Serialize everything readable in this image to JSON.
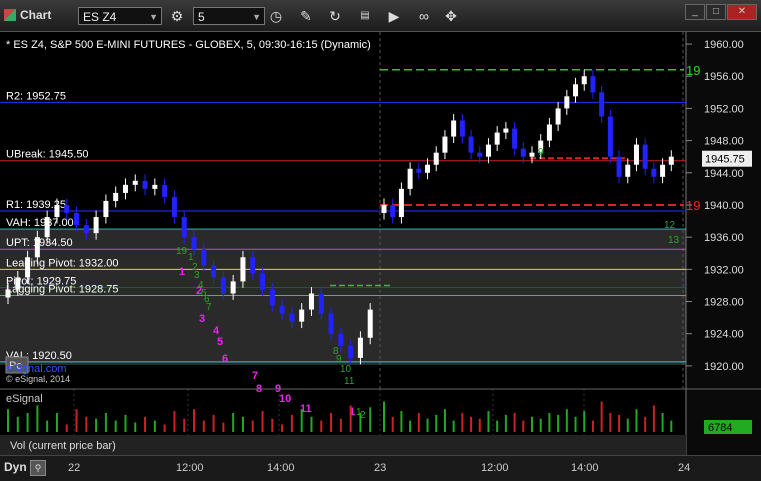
{
  "toolbar": {
    "title": "Chart",
    "symbol": "ES Z4",
    "interval": "5"
  },
  "chart": {
    "header": "* ES Z4, S&P 500 E-MINI FUTURES - GLOBEX, 5, 09:30-16:15 (Dynamic)",
    "copyright": "© eSignal, 2014",
    "watermark": "eSignal.com",
    "pc_label": "Pc",
    "volume_legend": "Vol (current price bar)",
    "volume_value": "6784",
    "last_price": "1945.75",
    "dyn_label": "Dyn"
  },
  "levels": [
    {
      "label": "R2: 1952.75",
      "price": 1952.75,
      "color": "#2233ff"
    },
    {
      "label": "UBreak: 1945.50",
      "price": 1945.5,
      "color": "#cc2020"
    },
    {
      "label": "R1: 1939.25",
      "price": 1939.25,
      "color": "#2233ff"
    },
    {
      "label": "VAH: 1937.00",
      "price": 1937.0,
      "color": "#33cccc"
    },
    {
      "label": "UPT: 1934.50",
      "price": 1934.5,
      "color": "#cc44cc"
    },
    {
      "label": "Leading Pivot: 1932.00",
      "price": 1932.0,
      "color": "#dddd33"
    },
    {
      "label": "Pivot: 1929.75",
      "price": 1929.75,
      "color": "#2233ff"
    },
    {
      "label": "Lagging Pivot: 1928.75",
      "price": 1928.75,
      "color": "#33cc33"
    },
    {
      "label": "VAL: 1920.50",
      "price": 1920.5,
      "color": "#33cccc"
    }
  ],
  "y_ticks": [
    "1960.00",
    "1956.00",
    "1952.00",
    "1948.00",
    "1944.00",
    "1940.00",
    "1936.00",
    "1932.00",
    "1928.00",
    "1924.00",
    "1920.00"
  ],
  "x_ticks": [
    "22",
    "12:00",
    "14:00",
    "23",
    "12:00",
    "14:00",
    "24"
  ],
  "counts": {
    "magenta": [
      "1",
      "2",
      "3",
      "4",
      "5",
      "6",
      "7",
      "8",
      "9",
      "10",
      "11",
      "1"
    ],
    "green": [
      "19",
      "1",
      "2",
      "3",
      "4",
      "5",
      "6",
      "7",
      "8",
      "9",
      "10",
      "11",
      "12",
      "13",
      "1",
      "2",
      "9"
    ],
    "red_marker": "19",
    "green_marker": "19"
  },
  "colors": {
    "up_candle": "#ffffff",
    "down_candle": "#2222ff",
    "volume_up": "#22aa22",
    "volume_down": "#cc2222"
  },
  "chart_data": {
    "type": "candlestick",
    "title": "* ES Z4, S&P 500 E-MINI FUTURES - GLOBEX, 5, 09:30-16:15 (Dynamic)",
    "ylim": [
      1918,
      1961
    ],
    "y_ticks": [
      1960,
      1956,
      1952,
      1948,
      1944,
      1940,
      1936,
      1932,
      1928,
      1924,
      1920
    ],
    "x_ticks": [
      "22",
      "12:00",
      "14:00",
      "23",
      "12:00",
      "14:00",
      "24"
    ],
    "closes": [
      1929.5,
      1931.0,
      1933.5,
      1936.0,
      1938.5,
      1940.0,
      1939.0,
      1937.5,
      1936.5,
      1938.5,
      1940.5,
      1941.5,
      1942.5,
      1943.0,
      1942.0,
      1942.5,
      1941.0,
      1938.5,
      1936.0,
      1934.5,
      1932.5,
      1931.0,
      1929.0,
      1930.5,
      1933.5,
      1931.5,
      1929.5,
      1927.5,
      1926.5,
      1925.5,
      1927.0,
      1929.0,
      1926.5,
      1924.0,
      1922.5,
      1921.0,
      1923.5,
      1927.0,
      1940.0,
      1938.5,
      1942.0,
      1944.5,
      1944.0,
      1945.0,
      1946.5,
      1948.5,
      1950.5,
      1948.5,
      1946.5,
      1946.0,
      1947.5,
      1949.0,
      1949.5,
      1947.0,
      1946.0,
      1946.5,
      1948.0,
      1950.0,
      1952.0,
      1953.5,
      1955.0,
      1956.0,
      1954.0,
      1951.0,
      1946.0,
      1943.5,
      1945.0,
      1947.5,
      1944.5,
      1943.5,
      1945.0,
      1946.0
    ],
    "volumes": [
      0.6,
      0.4,
      0.5,
      0.7,
      0.3,
      0.5,
      0.2,
      0.6,
      0.4,
      0.35,
      0.5,
      0.3,
      0.45,
      0.25,
      0.4,
      0.3,
      0.2,
      0.55,
      0.35,
      0.6,
      0.3,
      0.45,
      0.25,
      0.5,
      0.4,
      0.3,
      0.55,
      0.35,
      0.2,
      0.45,
      0.6,
      0.4,
      0.3,
      0.5,
      0.35,
      0.7,
      0.5,
      0.65,
      0.8,
      0.4,
      0.55,
      0.3,
      0.5,
      0.35,
      0.45,
      0.6,
      0.3,
      0.5,
      0.4,
      0.35,
      0.55,
      0.3,
      0.45,
      0.5,
      0.3,
      0.4,
      0.35,
      0.5,
      0.45,
      0.6,
      0.4,
      0.55,
      0.3,
      0.8,
      0.5,
      0.45,
      0.35,
      0.6,
      0.4,
      0.7,
      0.5,
      0.3
    ],
    "volume_last": 6784
  }
}
